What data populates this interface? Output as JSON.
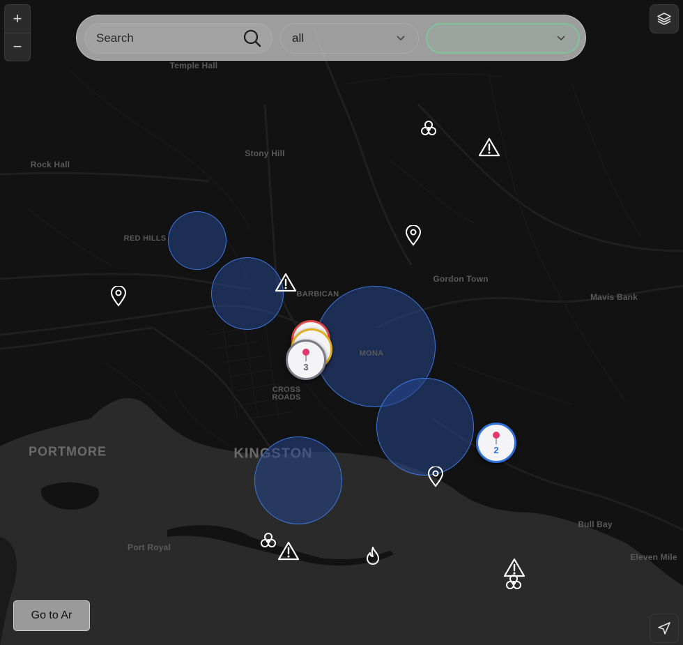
{
  "search": {
    "placeholder": "Search"
  },
  "type_filter": {
    "value": "all"
  },
  "status_filter": {
    "value": ""
  },
  "zoom": {
    "in": "+",
    "out": "−"
  },
  "goto_button": "Go to Ar",
  "places": {
    "temple_hall": "Temple Hall",
    "stony_hill": "Stony Hill",
    "rock_hall": "Rock Hall",
    "red_hills": "RED HILLS",
    "barbican": "BARBICAN",
    "gordon_town": "Gordon Town",
    "mavis_bank": "Mavis Bank",
    "mona": "MONA",
    "cross_roads_1": "CROSS",
    "cross_roads_2": "ROADS",
    "portmore": "PORTMORE",
    "kingston": "KINGSTON",
    "port_royal": "Port Royal",
    "bull_bay": "Bull Bay",
    "eleven_mile": "Eleven Mile"
  },
  "clusters": [
    {
      "count": "3",
      "color": "#5a5a6a"
    },
    {
      "count": "2",
      "color": "#2f6fd8"
    }
  ],
  "icons": [
    "search-icon",
    "chevron-down-icon",
    "layers-icon",
    "location-arrow-icon",
    "biohazard-icon",
    "warning-icon",
    "map-pin-icon",
    "fire-icon"
  ],
  "colors": {
    "accent_circle": "#3c76e0",
    "status_border": "#7ec497",
    "cluster_ring_red": "#e04848",
    "cluster_ring_yellow": "#e0b020"
  }
}
